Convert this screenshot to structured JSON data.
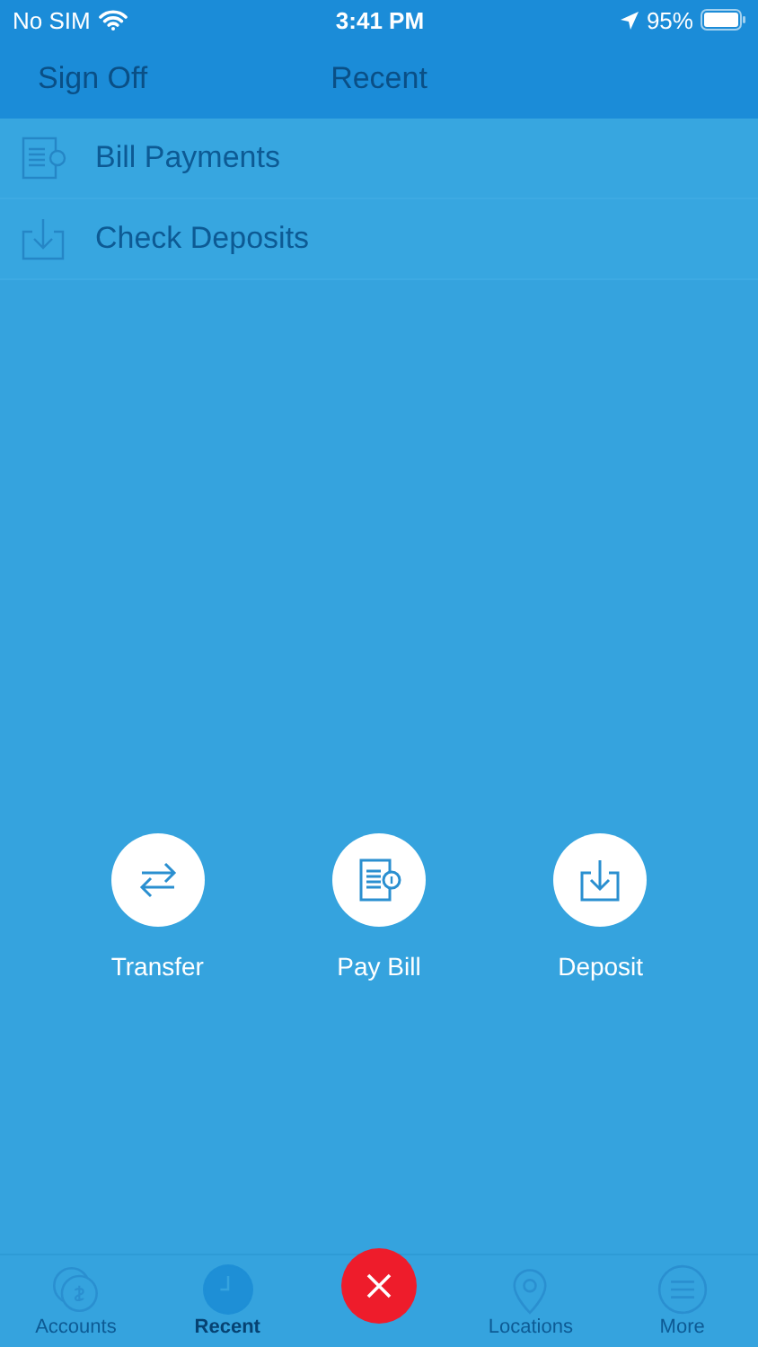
{
  "status_bar": {
    "carrier": "No SIM",
    "time": "3:41 PM",
    "battery": "95%"
  },
  "nav_bar": {
    "left_button": "Sign Off",
    "title": "Recent"
  },
  "list": [
    {
      "label": "Bill Payments"
    },
    {
      "label": "Check Deposits"
    }
  ],
  "actions": [
    {
      "label": "Transfer"
    },
    {
      "label": "Pay Bill"
    },
    {
      "label": "Deposit"
    }
  ],
  "tab_bar": [
    {
      "kind": "tab",
      "label": "Accounts",
      "selected": false
    },
    {
      "kind": "tab",
      "label": "Recent",
      "selected": true
    },
    {
      "kind": "close"
    },
    {
      "kind": "tab",
      "label": "Locations",
      "selected": false
    },
    {
      "kind": "tab",
      "label": "More",
      "selected": false
    }
  ]
}
